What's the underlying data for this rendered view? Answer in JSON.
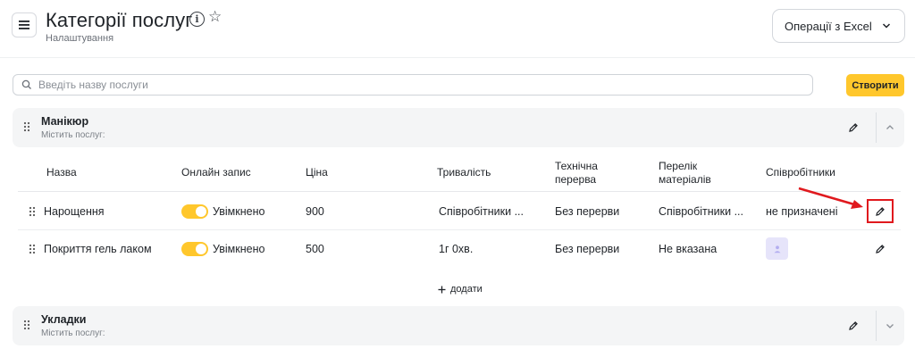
{
  "header": {
    "title": "Категорії послуг",
    "subtitle": "Налаштування",
    "excel_button": "Операції з Excel"
  },
  "search": {
    "placeholder": "Введіть назву послуги",
    "value": ""
  },
  "create_button": "Створити",
  "categories": [
    {
      "name": "Манікюр",
      "subtitle": "Містить послуг:",
      "expanded": true
    },
    {
      "name": "Укладки",
      "subtitle": "Містить послуг:",
      "expanded": false
    }
  ],
  "table": {
    "headers": {
      "name": "Назва",
      "online": "Онлайн запис",
      "price": "Ціна",
      "duration": "Тривалість",
      "break_l1": "Технічна",
      "break_l2": "перерва",
      "materials_l1": "Перелік",
      "materials_l2": "матеріалів",
      "employees": "Співробітники"
    },
    "rows": [
      {
        "name": "Нарощення",
        "online": "Увімкнено",
        "online_on": true,
        "price": "900",
        "duration": "Співробітники ...",
        "break": "Без перерви",
        "materials": "Співробітники ...",
        "employees": "не призначені"
      },
      {
        "name": "Покриття гель лаком",
        "online": "Увімкнено",
        "online_on": true,
        "price": "500",
        "duration": "1г 0хв.",
        "break": "Без перерви",
        "materials": "Не вказана",
        "employees": ""
      }
    ],
    "add_label": "додати"
  },
  "colors": {
    "accent": "#ffc72c",
    "highlight": "#e0191e",
    "panel": "#f4f5f6"
  },
  "icons": [
    "menu-icon",
    "info-icon",
    "star-icon",
    "chevron-down-icon",
    "search-icon",
    "drag-handle-icon",
    "pencil-icon",
    "chevron-up-icon",
    "user-icon",
    "plus-icon",
    "arrow-icon"
  ]
}
